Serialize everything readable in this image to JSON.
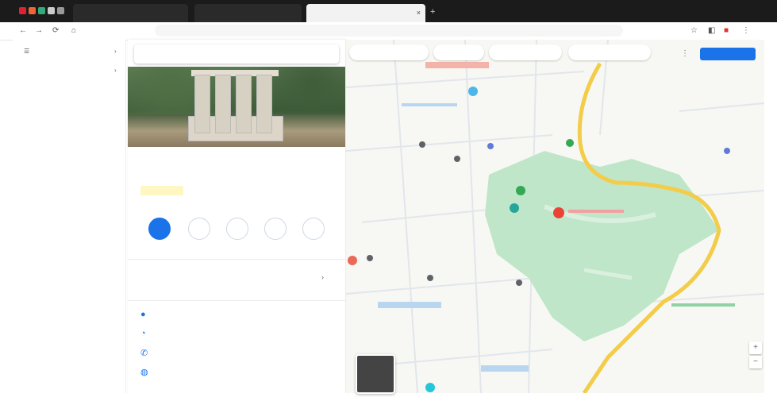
{
  "browser": {
    "tabs": [
      {
        "title": ""
      },
      {
        "title": ""
      },
      {
        "title": ""
      }
    ],
    "url": ""
  },
  "sidebar": {
    "items": [
      {
        "label": ""
      },
      {
        "label": ""
      }
    ]
  },
  "panel": {
    "search_placeholder": "",
    "place_title": "",
    "place_subtitle": "",
    "rating_text": "",
    "category": "",
    "actions": [
      {
        "label": ""
      },
      {
        "label": ""
      },
      {
        "label": ""
      },
      {
        "label": ""
      },
      {
        "label": ""
      }
    ],
    "description": "",
    "details": [
      {
        "icon": "pin-icon",
        "text": ""
      },
      {
        "icon": "clock-icon",
        "text": ""
      },
      {
        "icon": "phone-icon",
        "text": ""
      },
      {
        "icon": "globe-icon",
        "text": ""
      }
    ],
    "footer_link": ""
  },
  "map": {
    "filter_chips": [
      {
        "label": ""
      },
      {
        "label": ""
      },
      {
        "label": ""
      },
      {
        "label": ""
      }
    ],
    "signin_label": "",
    "labels": [
      {
        "text": ""
      },
      {
        "text": ""
      },
      {
        "text": ""
      }
    ],
    "footer": ""
  },
  "colors": {
    "accent": "#1a73e8",
    "park_green": "#bfe6c8",
    "road_yellow": "#f3cc4a",
    "pin_red": "#ea4335",
    "tab_bar": "#1b1b1b"
  }
}
